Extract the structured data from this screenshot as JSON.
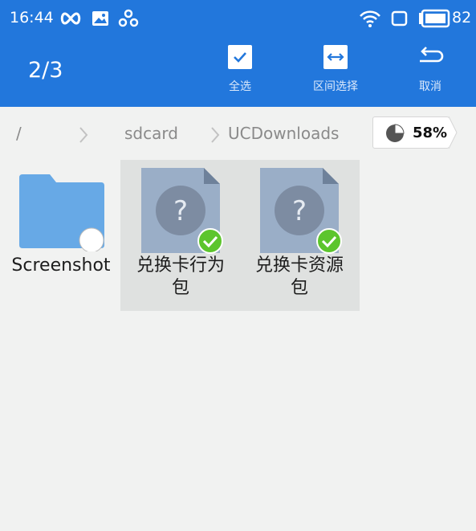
{
  "statusbar": {
    "time": "16:44",
    "battery": "82"
  },
  "appbar": {
    "selection_count": "2/3",
    "actions": [
      {
        "label": "全选",
        "icon": "checkbox-checked-icon"
      },
      {
        "label": "区间选择",
        "icon": "range-select-icon"
      },
      {
        "label": "取消",
        "icon": "undo-arrow-icon"
      }
    ]
  },
  "breadcrumb": {
    "root": "/",
    "items": [
      "sdcard",
      "UCDownloads"
    ]
  },
  "storage": {
    "percent": "58%",
    "used_fraction": 0.58
  },
  "files": [
    {
      "name": "Screenshot",
      "type": "folder",
      "selected": false
    },
    {
      "name_line1": "兑换卡行为",
      "name_line2": "包",
      "type": "unknown",
      "selected": true
    },
    {
      "name_line1": "兑换卡资源",
      "name_line2": "包",
      "type": "unknown",
      "selected": true
    }
  ],
  "colors": {
    "primary": "#2277dc",
    "check": "#5cc52d",
    "folder": "#67a9e6",
    "file": "#9aaec7"
  }
}
